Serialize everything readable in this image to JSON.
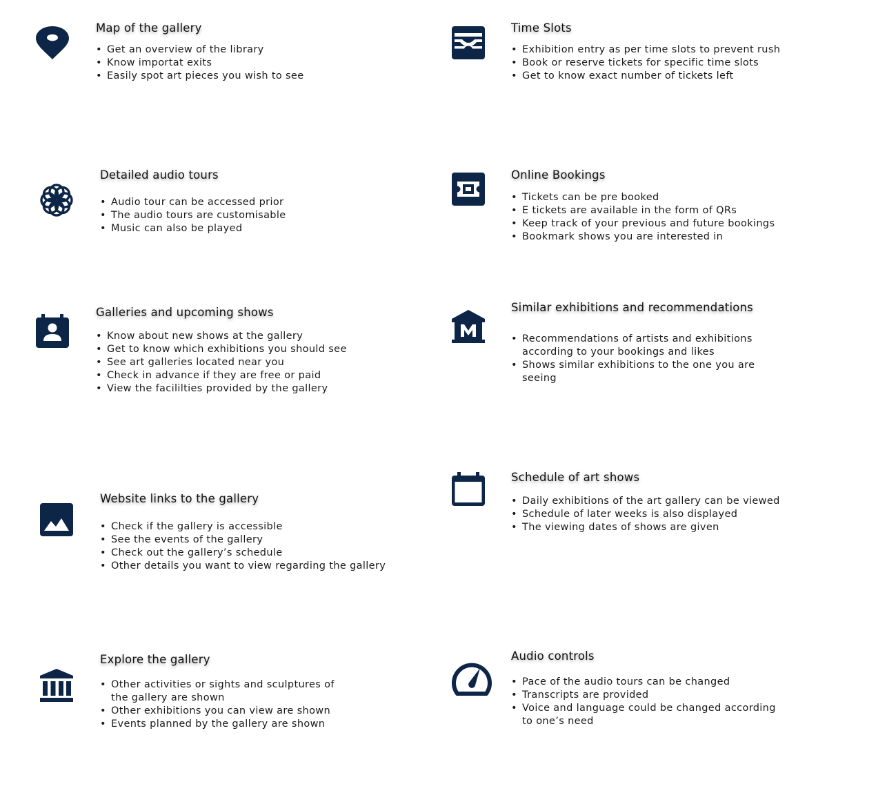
{
  "colors": {
    "icon": "#0d2547",
    "text": "#1a1a1a"
  },
  "features": [
    {
      "id": "map",
      "icon": "map-pin-icon",
      "title": "Map of the gallery",
      "bullets": [
        "Get an overview of the library",
        "Know importat exits",
        "Easily spot art pieces you wish to see"
      ]
    },
    {
      "id": "time-slots",
      "icon": "ticket-slots-icon",
      "title": "Time Slots",
      "bullets": [
        "Exhibition entry as per time slots to prevent rush",
        "Book or reserve tickets for specific time slots",
        "Get to know exact number of tickets left"
      ]
    },
    {
      "id": "audio-tours",
      "icon": "flower-icon",
      "title": "Detailed audio tours",
      "bullets": [
        "Audio tour can be accessed prior",
        "The audio tours are customisable",
        "Music can also be played"
      ]
    },
    {
      "id": "online-bookings",
      "icon": "ticket-icon",
      "title": "Online Bookings",
      "bullets": [
        "Tickets can be pre booked",
        "E tickets are available in the form of QRs",
        "Keep track of your previous and future bookings",
        "Bookmark shows you are interested in"
      ]
    },
    {
      "id": "galleries-shows",
      "icon": "contact-calendar-icon",
      "title": "Galleries and upcoming shows",
      "bullets": [
        "Know about new shows at the gallery",
        "Get to know which exhibitions you should see",
        "See art galleries located near you",
        "Check in advance if they are free or paid",
        "View the facililties provided by the gallery"
      ]
    },
    {
      "id": "recommendations",
      "icon": "museum-icon",
      "title": "Similar exhibitions and recommendations",
      "bullets": [
        "Recommendations of artists and exhibitions according to your bookings and likes",
        "Shows similar exhibitions to the one you are seeing"
      ]
    },
    {
      "id": "website-links",
      "icon": "image-icon",
      "title": "Website links to the gallery",
      "bullets": [
        "Check if the gallery is accessible",
        "See the events of the gallery",
        "Check out the gallery’s schedule",
        "Other details you want to view regarding the gallery"
      ]
    },
    {
      "id": "schedule",
      "icon": "calendar-icon",
      "title": "Schedule of art shows",
      "bullets": [
        "Daily exhibitions of the art gallery can be viewed",
        "Schedule of later weeks is also displayed",
        "The viewing dates of shows are given"
      ]
    },
    {
      "id": "explore",
      "icon": "bank-icon",
      "title": "Explore the gallery",
      "bullets": [
        "Other activities or sights and sculptures of the gallery are shown",
        "Other exhibitions you can view are shown",
        "Events planned by the gallery are shown"
      ]
    },
    {
      "id": "audio-controls",
      "icon": "speedometer-icon",
      "title": "Audio controls",
      "bullets": [
        "Pace of the audio tours can be changed",
        "Transcripts are provided",
        "Voice and language could be changed according to one’s need"
      ]
    }
  ]
}
